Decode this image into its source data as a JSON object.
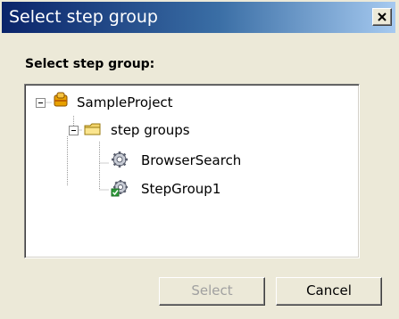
{
  "window": {
    "title": "Select step group"
  },
  "prompt_label": "Select step group:",
  "tree": {
    "root": {
      "label": "SampleProject",
      "icon": "project-icon",
      "expanded": true,
      "children": [
        {
          "label": "step groups",
          "icon": "folder-icon",
          "expanded": true,
          "children": [
            {
              "label": "BrowserSearch",
              "icon": "gear-icon"
            },
            {
              "label": "StepGroup1",
              "icon": "gear-check-icon"
            }
          ]
        }
      ]
    }
  },
  "buttons": {
    "select_label": "Select",
    "select_enabled": false,
    "cancel_label": "Cancel"
  }
}
